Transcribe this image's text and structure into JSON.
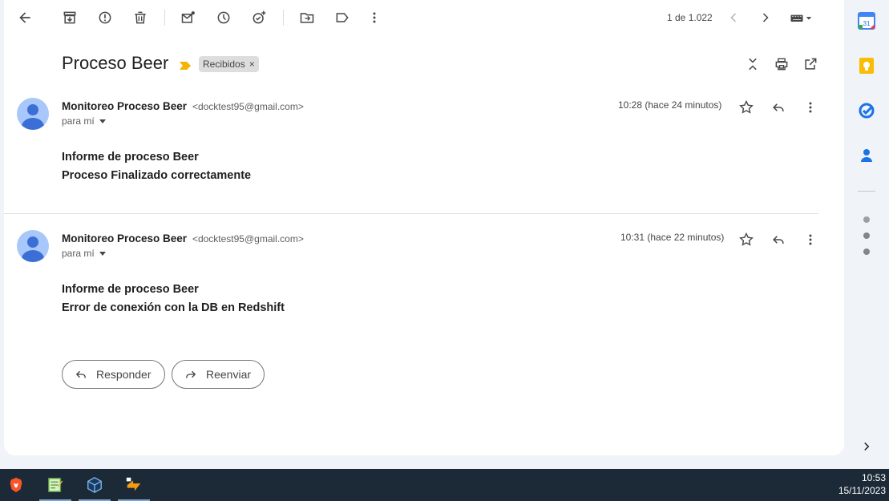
{
  "toolbar": {
    "icons": [
      "back-icon",
      "archive-icon",
      "report-spam-icon",
      "delete-icon",
      "mark-unread-icon",
      "snooze-icon",
      "add-task-icon",
      "move-to-icon",
      "label-icon",
      "more-vert-icon"
    ],
    "pager_text": "1 de 1.022"
  },
  "thread": {
    "subject": "Proceso Beer",
    "label": "Recibidos",
    "label_close": "×"
  },
  "messages": [
    {
      "sender_name": "Monitoreo Proceso Beer",
      "sender_email": "<docktest95@gmail.com>",
      "to": "para mí",
      "time": "10:28 (hace 24 minutos)",
      "body_line1": "Informe de proceso Beer",
      "body_line2": "Proceso Finalizado correctamente"
    },
    {
      "sender_name": "Monitoreo Proceso Beer",
      "sender_email": "<docktest95@gmail.com>",
      "to": "para mí",
      "time": "10:31 (hace 22 minutos)",
      "body_line1": "Informe de proceso Beer",
      "body_line2": "Error de conexión con la DB en Redshift"
    }
  ],
  "actions": {
    "reply_label": "Responder",
    "forward_label": "Reenviar"
  },
  "side_panel": {
    "calendar_day": "31",
    "apps": [
      "calendar-icon",
      "keep-icon",
      "tasks-icon",
      "contacts-icon"
    ]
  },
  "taskbar": {
    "time": "10:53",
    "date": "15/11/2023"
  },
  "colors": {
    "accent": "#0b57d0",
    "importance": "#f4b400",
    "taskbar": "#1b2a36"
  }
}
